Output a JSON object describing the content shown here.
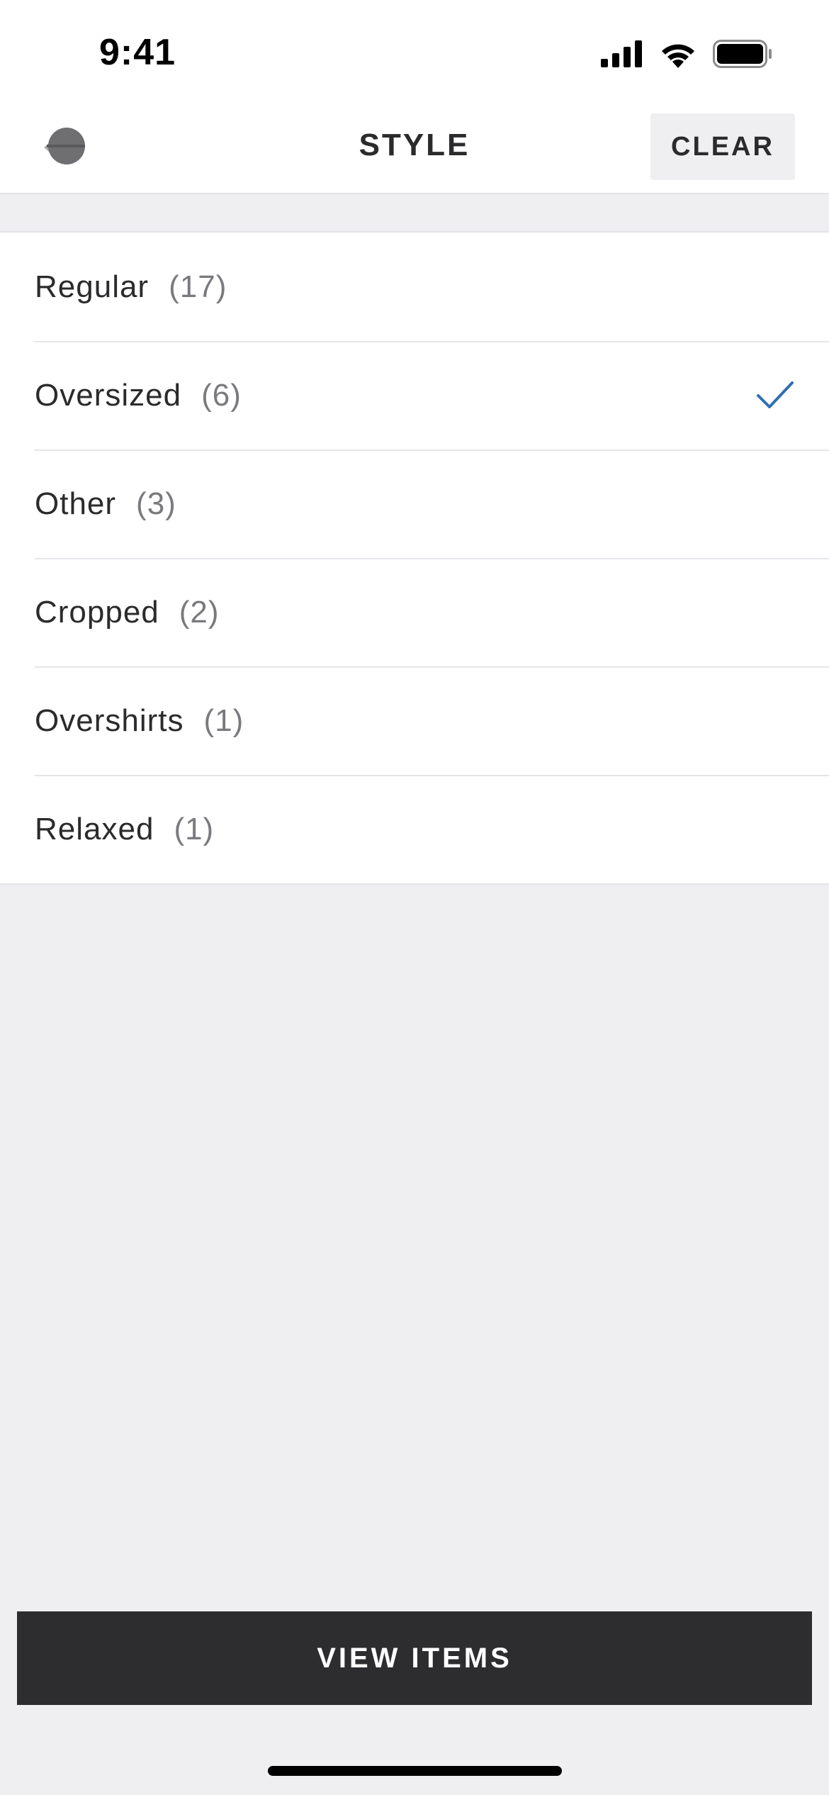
{
  "status_bar": {
    "time": "9:41",
    "icons": [
      "cellular-signal-icon",
      "wifi-icon",
      "battery-icon"
    ]
  },
  "nav": {
    "back_icon": "back-arrow-icon",
    "title": "STYLE",
    "clear_label": "CLEAR"
  },
  "options": [
    {
      "label": "Regular",
      "count": "(17)",
      "selected": false
    },
    {
      "label": "Oversized",
      "count": "(6)",
      "selected": true
    },
    {
      "label": "Other",
      "count": "(3)",
      "selected": false
    },
    {
      "label": "Cropped",
      "count": "(2)",
      "selected": false
    },
    {
      "label": "Overshirts",
      "count": "(1)",
      "selected": false
    },
    {
      "label": "Relaxed",
      "count": "(1)",
      "selected": false
    }
  ],
  "footer": {
    "view_items_label": "VIEW ITEMS"
  },
  "colors": {
    "background": "#efeef1",
    "surface": "#ffffff",
    "text": "#2b2b2d",
    "count_text": "#7a7a7e",
    "accent_check": "#2f6fb0",
    "primary_button": "#2d2c2f"
  }
}
